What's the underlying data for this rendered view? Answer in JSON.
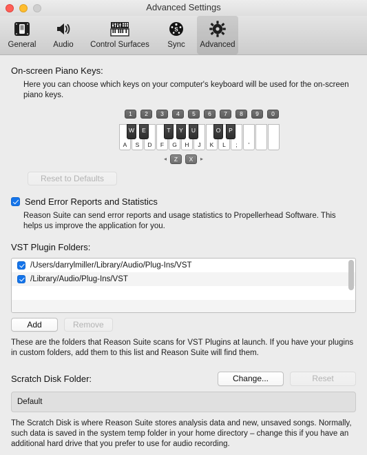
{
  "window": {
    "title": "Advanced Settings",
    "traffic_lights": [
      "close",
      "minimize",
      "zoom"
    ]
  },
  "toolbar": {
    "items": [
      {
        "label": "General",
        "icon": "general-icon",
        "selected": false
      },
      {
        "label": "Audio",
        "icon": "speaker-icon",
        "selected": false
      },
      {
        "label": "Control Surfaces",
        "icon": "keyboard-mixer-icon",
        "selected": false
      },
      {
        "label": "Sync",
        "icon": "sync-icon",
        "selected": false
      },
      {
        "label": "Advanced",
        "icon": "gear-icon",
        "selected": true
      }
    ]
  },
  "piano_section": {
    "title": "On-screen Piano Keys:",
    "help": "Here you can choose which keys on your computer's keyboard will be used for the on-screen piano keys.",
    "number_row": [
      "1",
      "2",
      "3",
      "4",
      "5",
      "6",
      "7",
      "8",
      "9",
      "0"
    ],
    "white_keys": [
      "A",
      "S",
      "D",
      "F",
      "G",
      "H",
      "J",
      "K",
      "L",
      ";",
      "'"
    ],
    "black_keys": [
      {
        "label": "W",
        "after_white": 0
      },
      {
        "label": "E",
        "after_white": 1
      },
      {
        "label": "T",
        "after_white": 3
      },
      {
        "label": "Y",
        "after_white": 4
      },
      {
        "label": "U",
        "after_white": 5
      },
      {
        "label": "O",
        "after_white": 7
      },
      {
        "label": "P",
        "after_white": 8
      }
    ],
    "transpose": {
      "left_arrow": "◂",
      "down_key": "Z",
      "up_key": "X",
      "right_arrow": "▸"
    },
    "reset_button": "Reset to Defaults"
  },
  "error_reports": {
    "checkbox_label": "Send Error Reports and Statistics",
    "checked": true,
    "help": "Reason Suite can send error reports and usage statistics to Propellerhead Software. This helps us improve the application for you."
  },
  "vst": {
    "title": "VST Plugin Folders:",
    "folders": [
      {
        "path": "/Users/darrylmiller/Library/Audio/Plug-Ins/VST",
        "checked": true
      },
      {
        "path": "/Library/Audio/Plug-Ins/VST",
        "checked": true
      }
    ],
    "add_button": "Add",
    "remove_button": "Remove",
    "note": "These are the folders that Reason Suite scans for VST Plugins at launch. If you have your plugins in custom folders, add them to this list and Reason Suite will find them."
  },
  "scratch": {
    "title": "Scratch Disk Folder:",
    "change_button": "Change...",
    "reset_button": "Reset",
    "path_value": "Default",
    "note": "The Scratch Disk is where Reason Suite stores analysis data and new, unsaved songs. Normally, such data is saved in the system temp folder in your home directory – change this if you have an additional hard drive that you prefer to use for audio recording."
  },
  "colors": {
    "accent": "#1474ea",
    "background": "#ececec",
    "toolbar_selected": "rgba(0,0,0,0.10)"
  }
}
